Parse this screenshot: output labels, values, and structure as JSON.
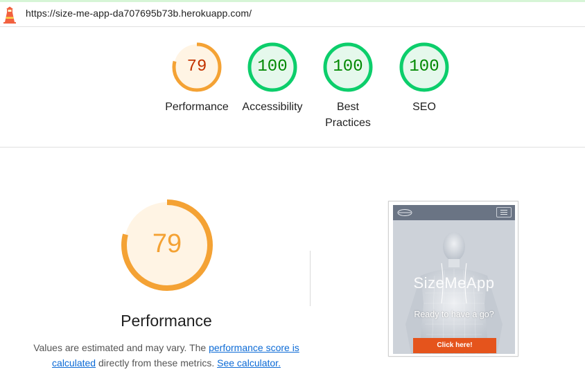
{
  "url": "https://size-me-app-da707695b73b.herokuapp.com/",
  "colors": {
    "average": "#f4a234",
    "pass": "#0cce6b",
    "average_text": "#c33300",
    "pass_text": "#008800"
  },
  "gauges": [
    {
      "label": "Performance",
      "score": "79",
      "fraction": 0.79
    },
    {
      "label": "Accessibility",
      "score": "100",
      "fraction": 1.0
    },
    {
      "label": "Best Practices",
      "score": "100",
      "fraction": 1.0
    },
    {
      "label": "SEO",
      "score": "100",
      "fraction": 1.0
    }
  ],
  "performance": {
    "score": "79",
    "fraction": 0.79,
    "title": "Performance",
    "description": {
      "text1": "Values are estimated and may vary. The ",
      "link1": "performance score is calculated",
      "text2": " directly from these metrics. ",
      "link2": "See calculator."
    }
  },
  "screenshot": {
    "brand": "SizeMeApp",
    "tagline": "Ready to have a go?",
    "cta": "Click here!"
  }
}
